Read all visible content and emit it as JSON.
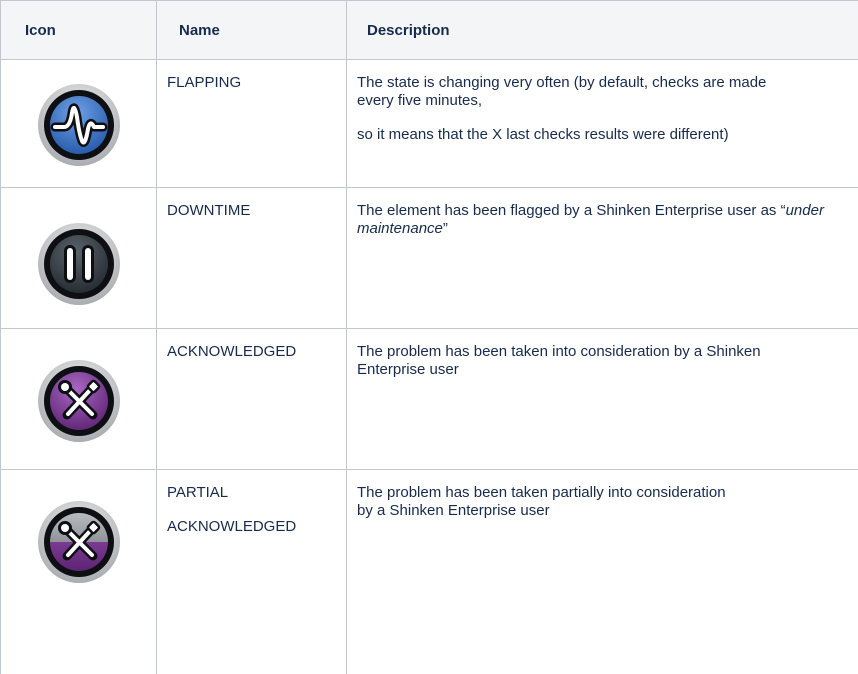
{
  "table": {
    "headers": [
      "Icon",
      "Name",
      "Description"
    ],
    "rows": [
      {
        "icon": "flapping-icon",
        "name": [
          "FLAPPING"
        ],
        "description": [
          "The state is changing very often (by default, checks are made every five minutes,",
          "so it means that the X last checks results were different)"
        ]
      },
      {
        "icon": "downtime-icon",
        "name": [
          "DOWNTIME"
        ],
        "description_prefix": "The element has been flagged by a Shinken Enterprise user as “",
        "description_em": "under maintenance",
        "description_suffix": "”"
      },
      {
        "icon": "acknowledged-icon",
        "name": [
          "ACKNOWLEDGED"
        ],
        "description": [
          "The problem has been taken into consideration by a Shinken Enterprise user"
        ]
      },
      {
        "icon": "partial-acknowledged-icon",
        "name": [
          "PARTIAL",
          "ACKNOWLEDGED"
        ],
        "description": [
          "The problem has been taken partially into consideration",
          "by a Shinken Enterprise user"
        ]
      }
    ]
  },
  "colors": {
    "flapping": "#3d74c4",
    "downtime": "#3b434b",
    "acknowledged": "#7b3a93",
    "partial": "#8a8f96"
  }
}
